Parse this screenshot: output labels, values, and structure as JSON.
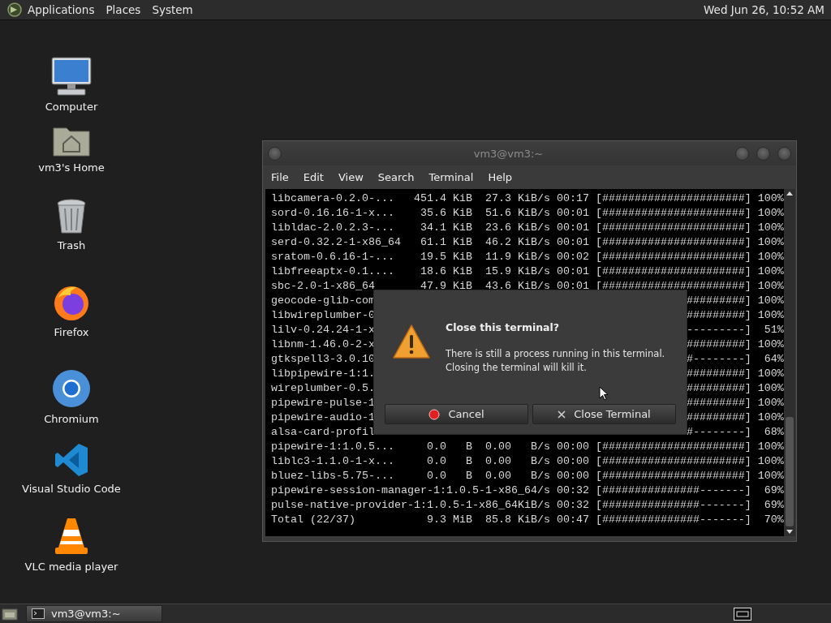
{
  "top_panel": {
    "menus": [
      "Applications",
      "Places",
      "System"
    ],
    "clock": "Wed Jun 26, 10:52 AM"
  },
  "desktop_icons": [
    {
      "kind": "computer",
      "label": "Computer"
    },
    {
      "kind": "home",
      "label": "vm3's Home"
    },
    {
      "kind": "trash",
      "label": "Trash"
    },
    {
      "kind": "firefox",
      "label": "Firefox"
    },
    {
      "kind": "chromium",
      "label": "Chromium"
    },
    {
      "kind": "vscode",
      "label": "Visual Studio Code"
    },
    {
      "kind": "vlc",
      "label": "VLC media player"
    }
  ],
  "terminal_window": {
    "title": "vm3@vm3:~",
    "menu": [
      "File",
      "Edit",
      "View",
      "Search",
      "Terminal",
      "Help"
    ],
    "lines": [
      {
        "kind": "full",
        "text": "libcamera-0.2.0-...   451.4 KiB  27.3 KiB/s 00:17 [######################] 100%"
      },
      {
        "kind": "full",
        "text": "sord-0.16.16-1-x...    35.6 KiB  51.6 KiB/s 00:01 [######################] 100%"
      },
      {
        "kind": "full",
        "text": "libldac-2.0.2.3-...    34.1 KiB  23.6 KiB/s 00:01 [######################] 100%"
      },
      {
        "kind": "full",
        "text": "serd-0.32.2-1-x86_64   61.1 KiB  46.2 KiB/s 00:01 [######################] 100%"
      },
      {
        "kind": "full",
        "text": "sratom-0.6.16-1-...    19.5 KiB  11.9 KiB/s 00:02 [######################] 100%"
      },
      {
        "kind": "full",
        "text": "libfreeaptx-0.1....    18.6 KiB  15.9 KiB/s 00:01 [######################] 100%"
      },
      {
        "kind": "full",
        "text": "sbc-2.0-1-x86_64       47.9 KiB  43.6 KiB/s 00:01 [######################] 100%"
      },
      {
        "kind": "covered",
        "left": "geocode-glib-com",
        "right": "#########] 100%"
      },
      {
        "kind": "covered",
        "left": "libwireplumber-0",
        "right": "#########] 100%"
      },
      {
        "kind": "covered",
        "left": "lilv-0.24.24-1-x",
        "right": "---------]  51%"
      },
      {
        "kind": "covered",
        "left": "libnm-1.46.0-2-x",
        "right": "#########] 100%"
      },
      {
        "kind": "covered",
        "left": "gtkspell3-3.0.10",
        "right": "#--------]  64%"
      },
      {
        "kind": "covered",
        "left": "libpipewire-1:1.",
        "right": "#########] 100%"
      },
      {
        "kind": "covered",
        "left": "wireplumber-0.5.",
        "right": "#########] 100%"
      },
      {
        "kind": "covered",
        "left": "pipewire-pulse-1",
        "right": "#########] 100%"
      },
      {
        "kind": "covered",
        "left": "pipewire-audio-1",
        "right": "#########] 100%"
      },
      {
        "kind": "covered",
        "left": "alsa-card-profil",
        "right": "#--------]  68%"
      },
      {
        "kind": "full",
        "text": "pipewire-1:1.0.5...     0.0   B  0.00   B/s 00:00 [######################] 100%"
      },
      {
        "kind": "full",
        "text": "liblc3-1.1.0-1-x...     0.0   B  0.00   B/s 00:00 [######################] 100%"
      },
      {
        "kind": "full",
        "text": "bluez-libs-5.75-...     0.0   B  0.00   B/s 00:00 [######################] 100%"
      },
      {
        "kind": "full",
        "text": "pipewire-session-manager-1:1.0.5-1-x86_64/s 00:32 [###############-------]  69%"
      },
      {
        "kind": "full",
        "text": "pulse-native-provider-1:1.0.5-1-x86_64KiB/s 00:32 [###############-------]  69%"
      },
      {
        "kind": "full",
        "text": "Total (22/37)           9.3 MiB  85.8 KiB/s 00:47 [###############-------]  70%"
      }
    ]
  },
  "dialog": {
    "title": "Close this terminal?",
    "message": "There is still a process running in this terminal.\nClosing the terminal will kill it.",
    "buttons": [
      {
        "kind": "cancel",
        "label": "Cancel"
      },
      {
        "kind": "close",
        "label": "Close Terminal"
      }
    ]
  },
  "taskbar": {
    "tasks": [
      {
        "label": "vm3@vm3:~"
      }
    ]
  }
}
